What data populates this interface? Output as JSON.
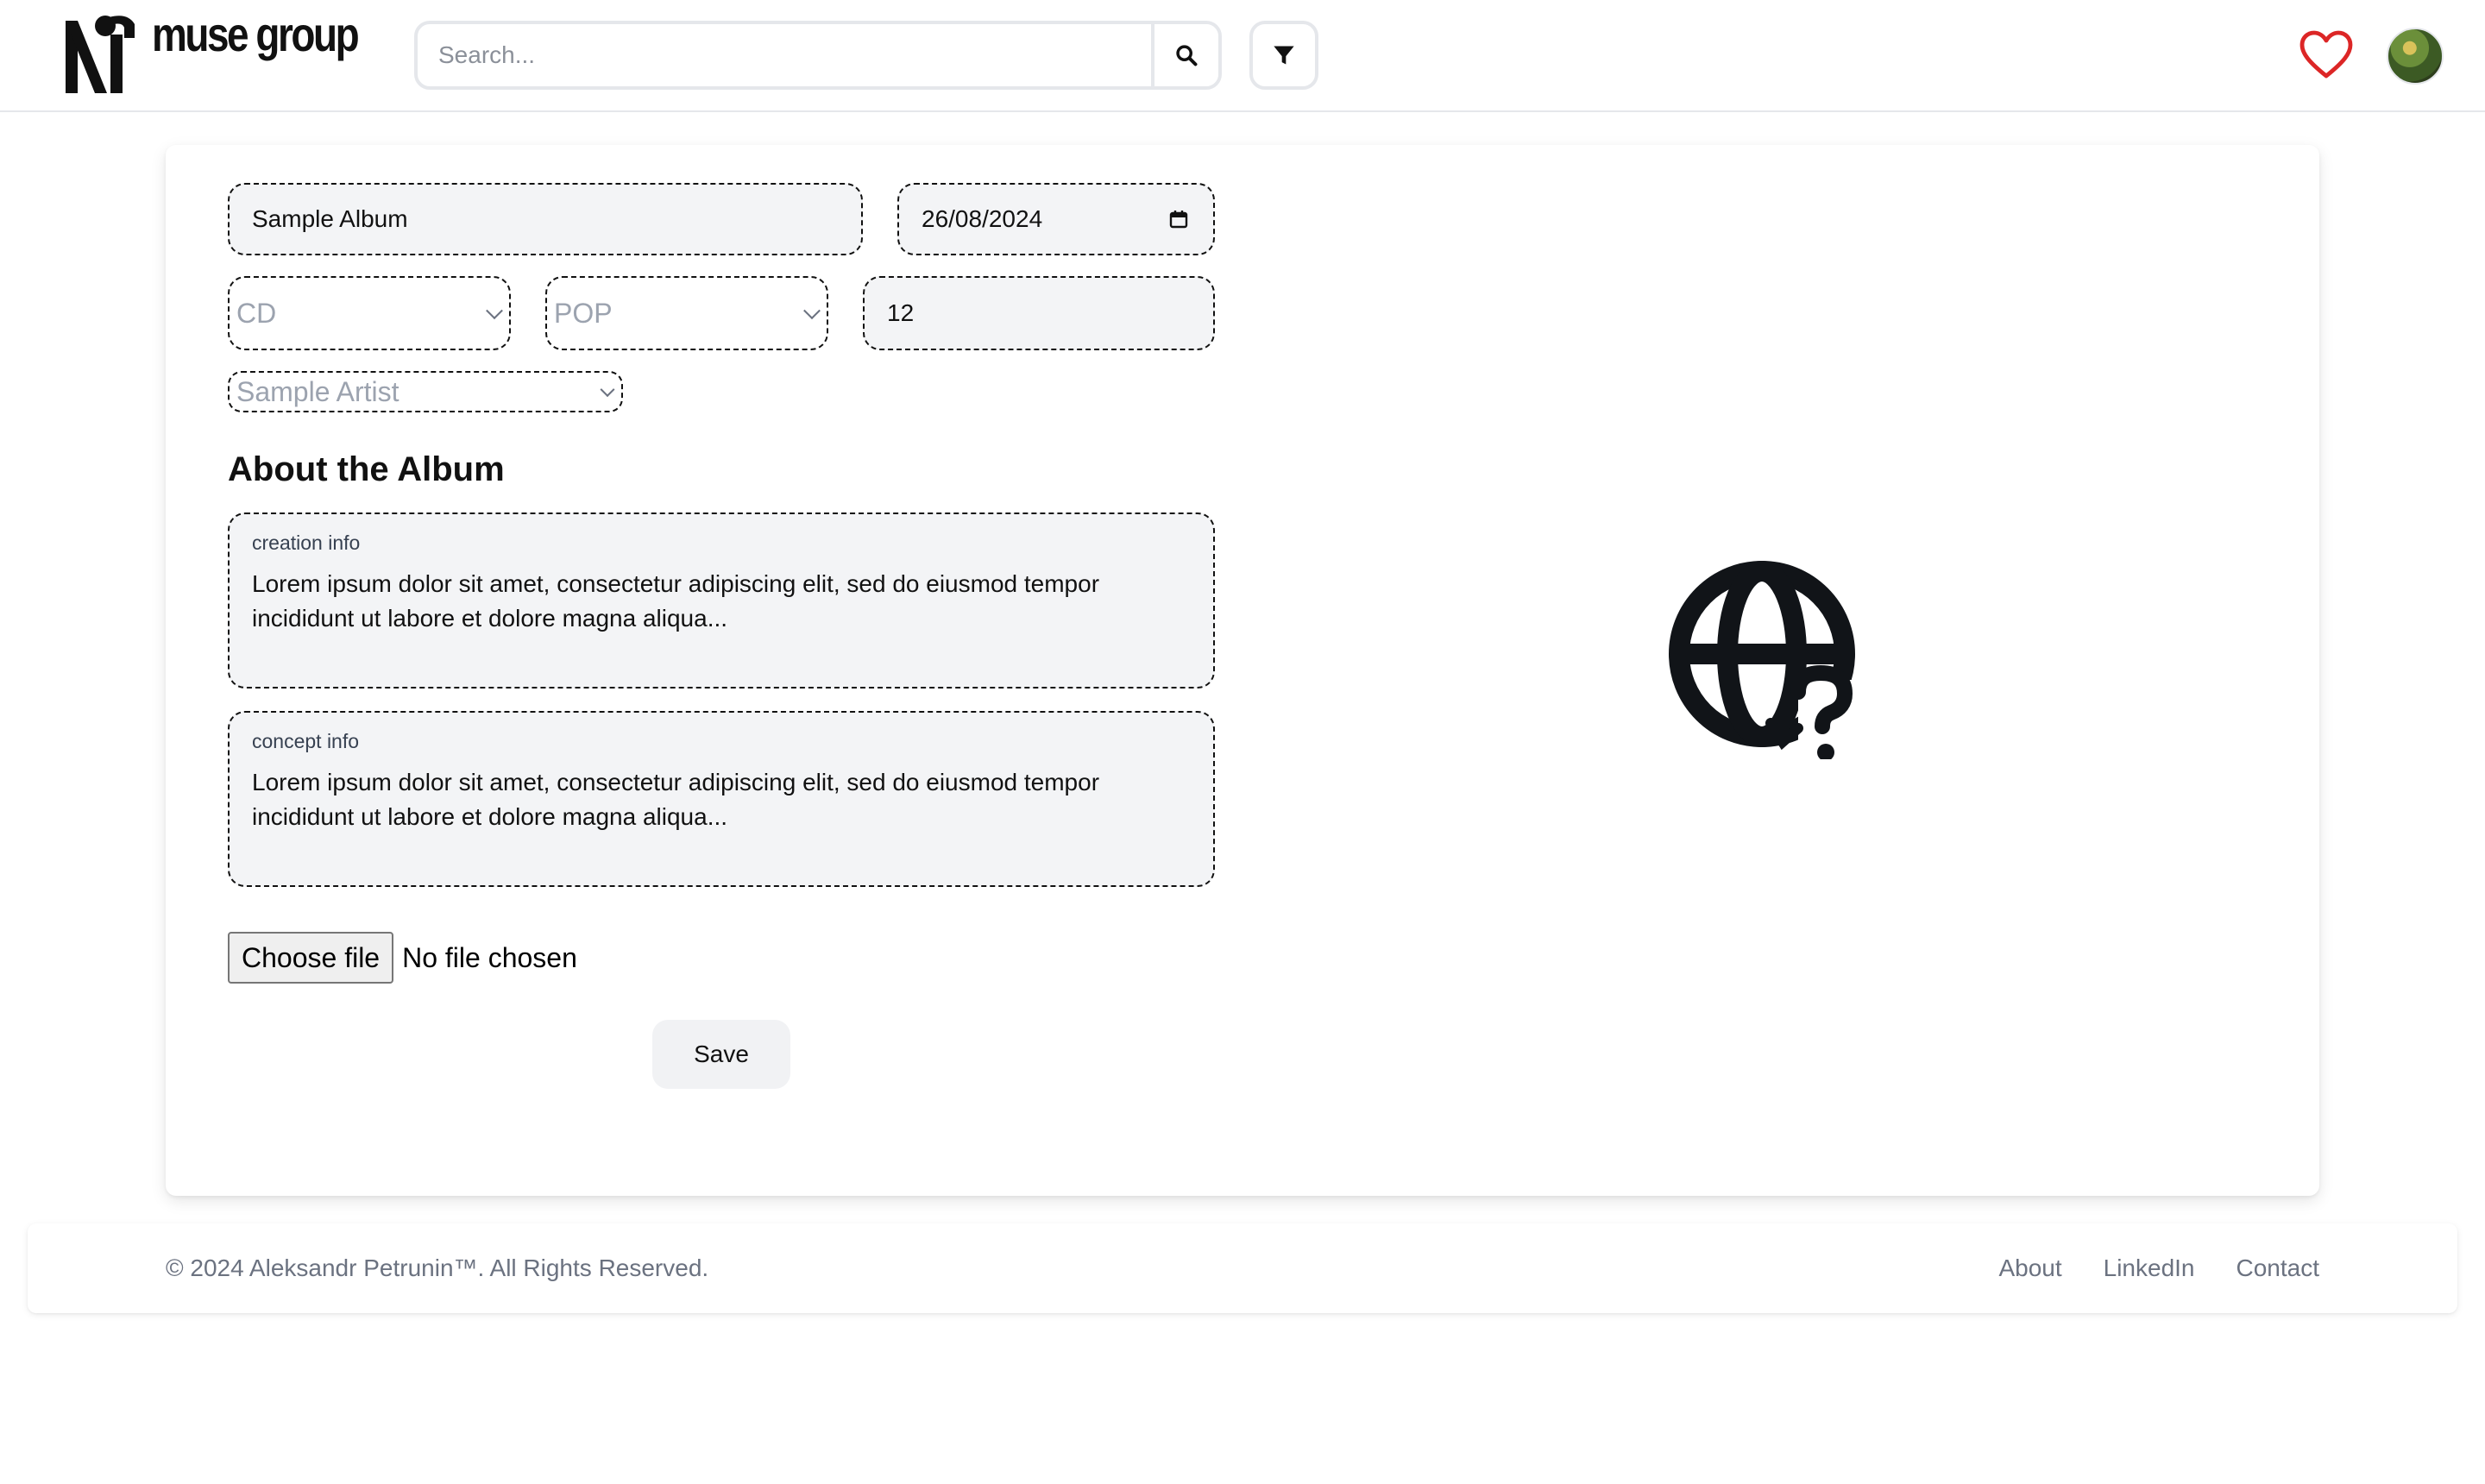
{
  "header": {
    "brand": "muse group",
    "search_placeholder": "Search...",
    "search_icon": "magnifier-icon",
    "filter_icon": "funnel-icon",
    "favorites_icon": "heart-icon",
    "heart_color": "#dc2626",
    "avatar": "user-avatar"
  },
  "form": {
    "album_title": "Sample Album",
    "release_date": "26/08/2024",
    "format": "CD",
    "genre": "POP",
    "track_count": "12",
    "artist": "Sample Artist",
    "section_title": "About the Album",
    "creation_label": "creation info",
    "creation_text": "Lorem ipsum dolor sit amet, consectetur adipiscing elit, sed do eiusmod tempor incididunt ut labore et dolore magna aliqua...",
    "concept_label": "concept info",
    "concept_text": "Lorem ipsum dolor sit amet, consectetur adipiscing elit, sed do eiusmod tempor incididunt ut labore et dolore magna aliqua...",
    "file_button": "Choose file",
    "file_status": "No file chosen",
    "save_label": "Save",
    "image_placeholder_icon": "globe-question-icon"
  },
  "footer": {
    "copyright": "© 2024 Aleksandr Petrunin™. All Rights Reserved.",
    "links": [
      "About",
      "LinkedIn",
      "Contact"
    ]
  }
}
